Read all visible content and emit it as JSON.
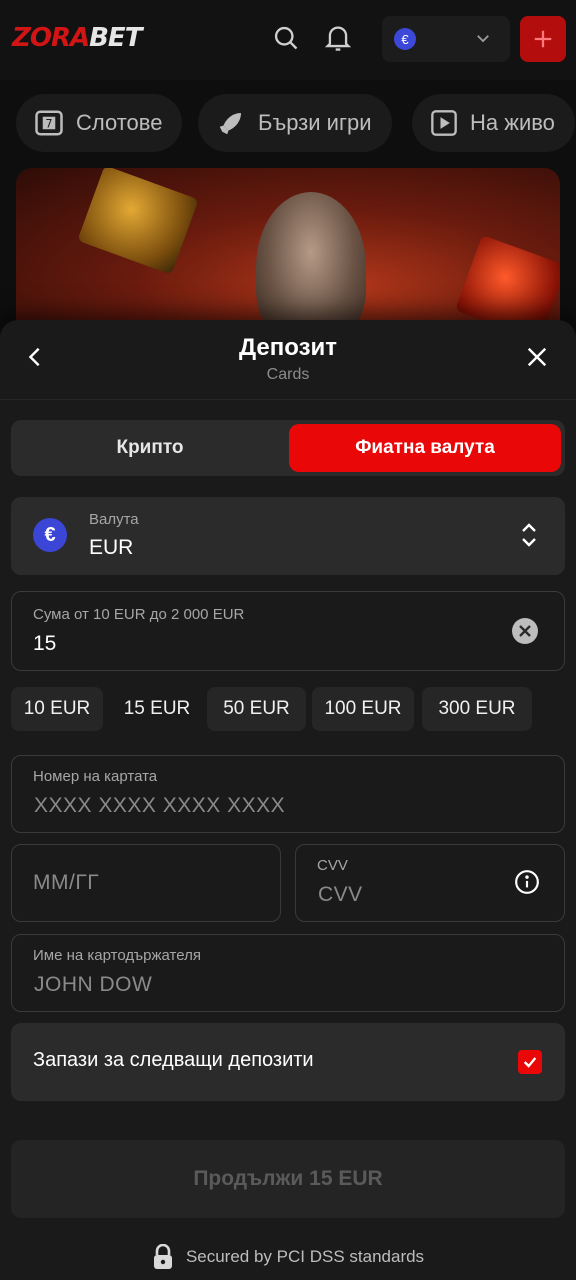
{
  "header": {
    "logo_part1": "ZORA",
    "logo_part2": "BET",
    "currency_symbol": "€",
    "icons": [
      "search-icon",
      "bell-icon",
      "chevron-down-icon",
      "plus-icon"
    ]
  },
  "categories": [
    {
      "label": "Слотове",
      "icon": "slot-icon"
    },
    {
      "label": "Бързи игри",
      "icon": "rocket-icon"
    },
    {
      "label": "На живо",
      "icon": "play-icon"
    }
  ],
  "modal": {
    "title": "Депозит",
    "subtitle": "Cards",
    "tabs": {
      "crypto": "Крипто",
      "fiat": "Фиатна валута",
      "active": "fiat"
    },
    "currency": {
      "label": "Валута",
      "value": "EUR",
      "symbol": "€"
    },
    "amount": {
      "label": "Сума от 10 EUR до 2 000 EUR",
      "value": "15"
    },
    "quick_amounts": [
      "10 EUR",
      "15 EUR",
      "50 EUR",
      "100 EUR",
      "300 EUR"
    ],
    "selected_quick_amount": "15 EUR",
    "card_number": {
      "label": "Номер на картата",
      "placeholder": "XXXX XXXX XXXX XXXX"
    },
    "expiry": {
      "placeholder": "ММ/ГГ"
    },
    "cvv": {
      "label": "CVV",
      "placeholder": "CVV"
    },
    "holder": {
      "label": "Име на картодържателя",
      "placeholder": "JOHN DOW"
    },
    "save_card": {
      "label": "Запази за следващи депозити",
      "checked": true
    },
    "continue_label": "Продължи 15 EUR",
    "secure_text": "Secured by PCI DSS standards"
  },
  "colors": {
    "accent": "#e90707",
    "euro_badge": "#3b46d6",
    "surface": "#2b2b2b",
    "background": "#1a1a1a"
  }
}
